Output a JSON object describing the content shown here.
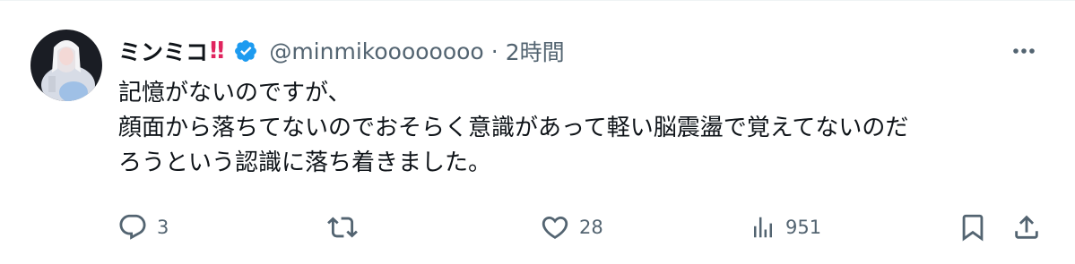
{
  "tweet": {
    "display_name": "ミンミコ",
    "name_emoji": "‼",
    "handle": "@minmikoooooooo",
    "separator": "·",
    "time": "2時間",
    "text_lines": [
      "記憶がないのですが、",
      "顔面から落ちてないのでおそらく意識があって軽い脳震盪で覚えてないのだ",
      "ろうという認識に落ち着きました。"
    ]
  },
  "actions": {
    "reply_count": "3",
    "retweet_count": "",
    "like_count": "28",
    "views_count": "951"
  },
  "icons": {
    "verified": "verified-badge-icon",
    "more": "more-dots-icon",
    "reply": "reply-icon",
    "retweet": "retweet-icon",
    "like": "heart-icon",
    "views": "views-bar-chart-icon",
    "bookmark": "bookmark-icon",
    "share": "share-icon"
  },
  "colors": {
    "text": "#0f1419",
    "secondary": "#536471",
    "verified": "#1d9bf0",
    "emoji_red": "#e0245e"
  }
}
